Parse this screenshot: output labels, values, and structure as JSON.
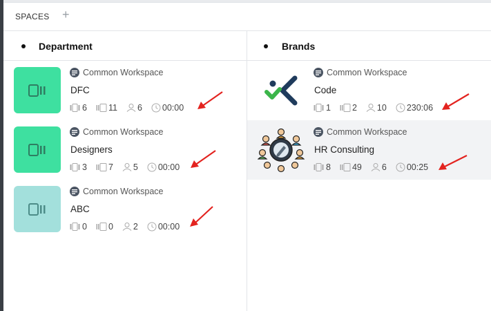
{
  "header": {
    "title": "SPACES",
    "add_label": "+"
  },
  "columns": [
    {
      "title": "Department",
      "cards": [
        {
          "workspace": "Common Workspace",
          "name": "DFC",
          "lists": "6",
          "folders": "11",
          "members": "6",
          "time": "00:00",
          "thumb_color": "#3ee0a0"
        },
        {
          "workspace": "Common Workspace",
          "name": "Designers",
          "lists": "3",
          "folders": "7",
          "members": "5",
          "time": "00:00",
          "thumb_color": "#3ee0a0"
        },
        {
          "workspace": "Common Workspace",
          "name": "ABC",
          "lists": "0",
          "folders": "0",
          "members": "2",
          "time": "00:00",
          "thumb_color": "#a3e0dc"
        }
      ]
    },
    {
      "title": "Brands",
      "cards": [
        {
          "workspace": "Common Workspace",
          "name": "Code",
          "lists": "1",
          "folders": "2",
          "members": "10",
          "time": "230:06",
          "logo": "code-logo"
        },
        {
          "workspace": "Common Workspace",
          "name": "HR Consulting",
          "lists": "8",
          "folders": "49",
          "members": "6",
          "time": "00:25",
          "logo": "hr-consulting-logo"
        }
      ]
    }
  ],
  "colors": {
    "arrow": "#e3231f",
    "accent_green": "#3ee0a0",
    "pale_teal": "#a3e0dc",
    "highlight": "#f2f3f5"
  }
}
